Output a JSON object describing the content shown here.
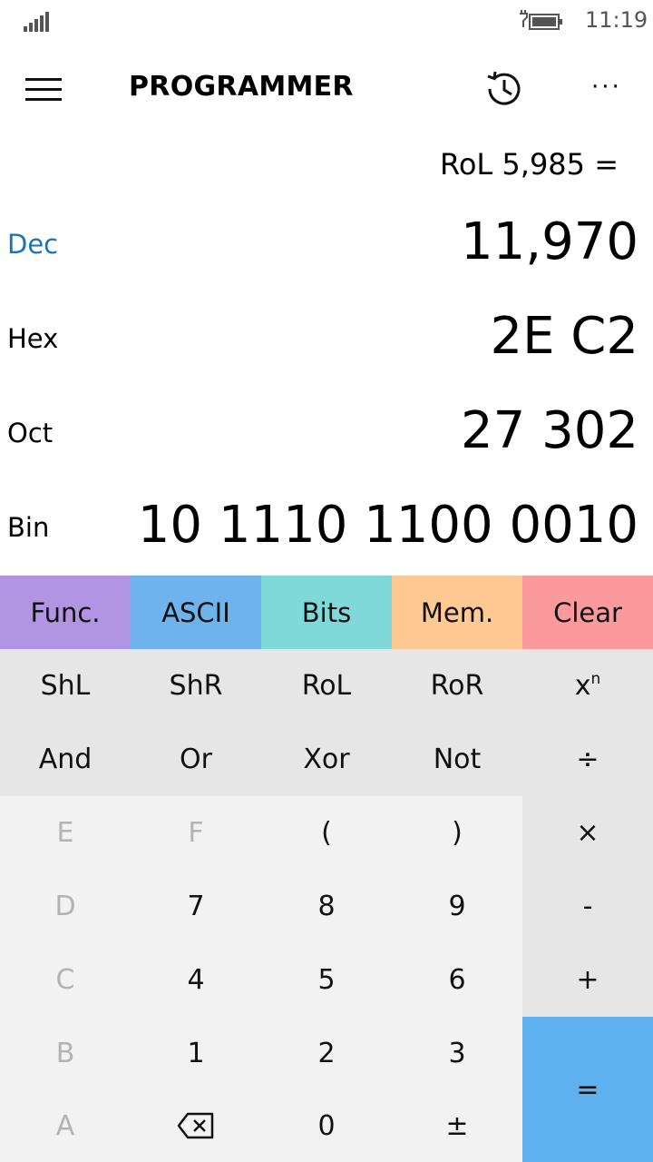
{
  "status_bar": {
    "time": "11:19",
    "signal_icon": "signal-bars-icon",
    "battery_icon": "battery-charging-icon"
  },
  "header": {
    "title": "PROGRAMMER",
    "menu_icon": "hamburger-menu-icon",
    "history_icon": "history-icon",
    "more_icon": "more-options-icon"
  },
  "expression": "RoL 5,985 =",
  "displays": [
    {
      "label": "Dec",
      "value": "11,970",
      "active": true
    },
    {
      "label": "Hex",
      "value": "2E C2",
      "active": false
    },
    {
      "label": "Oct",
      "value": "27 302",
      "active": false
    },
    {
      "label": "Bin",
      "value": "10 1110 1100 0010",
      "active": false
    }
  ],
  "categories": [
    {
      "label": "Func.",
      "color": "#b195e3"
    },
    {
      "label": "ASCII",
      "color": "#6fb3ec"
    },
    {
      "label": "Bits",
      "color": "#80d9d9"
    },
    {
      "label": "Mem.",
      "color": "#fec992"
    },
    {
      "label": "Clear",
      "color": "#fb9a9c"
    }
  ],
  "keys": {
    "row1": [
      "ShL",
      "ShR",
      "RoL",
      "RoR"
    ],
    "power_base": "x",
    "power_exp": "n",
    "row2": [
      "And",
      "Or",
      "Xor",
      "Not",
      "÷"
    ],
    "row3": [
      "E",
      "F",
      "(",
      ")",
      "×"
    ],
    "row4": [
      "D",
      "7",
      "8",
      "9",
      "-"
    ],
    "row5": [
      "C",
      "4",
      "5",
      "6",
      "+"
    ],
    "row6": [
      "B",
      "1",
      "2",
      "3"
    ],
    "row7": [
      "A",
      "0",
      "±"
    ],
    "backspace_icon": "backspace-icon",
    "equals": "="
  },
  "colors": {
    "accent_label": "#1a73b8",
    "equals_key": "#5eb0ef"
  }
}
